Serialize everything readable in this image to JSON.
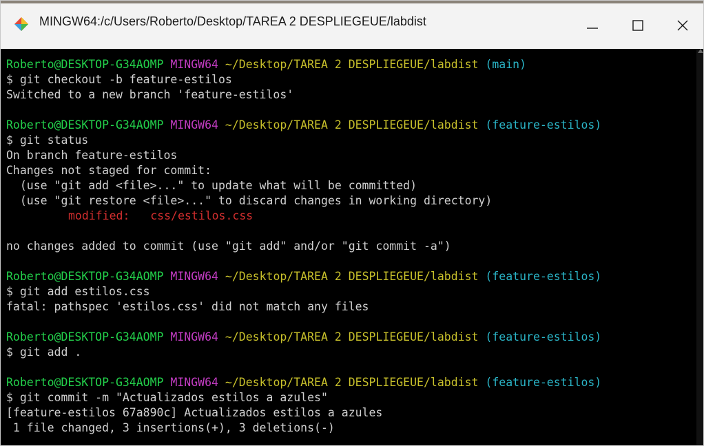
{
  "window": {
    "title": "MINGW64:/c/Users/Roberto/Desktop/TAREA 2 DESPLIEGEUE/labdist",
    "icon": "git-bash-diamond-icon",
    "controls": [
      "minimize-icon",
      "maximize-icon",
      "close-icon"
    ]
  },
  "colors": {
    "user": "#23d14b",
    "host": "#c23cc2",
    "path": "#c8c02b",
    "branch": "#2ab4c6",
    "modified": "#d22e2e",
    "text": "#d0d0d0",
    "background": "#000000"
  },
  "prompt": {
    "user": "Roberto@DESKTOP-G34AOMP",
    "host": "MINGW64",
    "path": "~/Desktop/TAREA 2 DESPLIEGEUE/labdist"
  },
  "terminal": {
    "p1_branch": "(main)",
    "cmd1": "$ git checkout -b feature-estilos",
    "out1": "Switched to a new branch 'feature-estilos'",
    "p2_branch": "(feature-estilos)",
    "cmd2": "$ git status",
    "out2_1": "On branch feature-estilos",
    "out2_2": "Changes not staged for commit:",
    "out2_3": "  (use \"git add <file>...\" to update what will be committed)",
    "out2_4": "  (use \"git restore <file>...\" to discard changes in working directory)",
    "out2_5_label": "modified:   ",
    "out2_5_file": "css/estilos.css",
    "out2_6": "no changes added to commit (use \"git add\" and/or \"git commit -a\")",
    "p3_branch": "(feature-estilos)",
    "cmd3": "$ git add estilos.css",
    "out3": "fatal: pathspec 'estilos.css' did not match any files",
    "p4_branch": "(feature-estilos)",
    "cmd4": "$ git add .",
    "p5_branch": "(feature-estilos)",
    "cmd5": "$ git commit -m \"Actualizados estilos a azules\"",
    "out5_1": "[feature-estilos 67a890c] Actualizados estilos a azules",
    "out5_2": " 1 file changed, 3 insertions(+), 3 deletions(-)"
  }
}
